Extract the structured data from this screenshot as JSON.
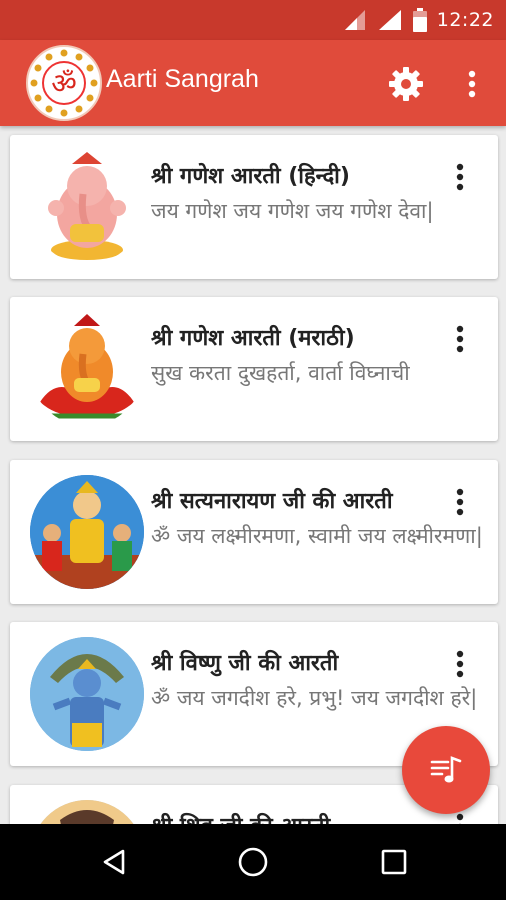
{
  "status_bar": {
    "time": "12:22",
    "icons": [
      "signal-icon",
      "wifi-icon",
      "battery-icon"
    ]
  },
  "app_bar": {
    "title": "Aarti Sangrah",
    "logo_icon": "om-icon",
    "actions": [
      "settings-icon",
      "overflow-menu-icon"
    ],
    "color": "#e04b3b"
  },
  "aartis": [
    {
      "title": "श्री गणेश आरती (हिन्दी)",
      "subtitle": "जय गणेश जय गणेश जय गणेश देवा|",
      "image": "ganesh-pink-image"
    },
    {
      "title": "श्री गणेश आरती (मराठी)",
      "subtitle": "सुख करता दुखहर्ता, वार्ता विघ्नाची",
      "image": "ganesh-lotus-image"
    },
    {
      "title": "श्री सत्यनारायण जी की आरती",
      "subtitle": "ॐ जय लक्ष्मीरमणा, स्वामी जय लक्ष्मीरमणा|",
      "image": "satyanarayan-image"
    },
    {
      "title": "श्री विष्णु जी की आरती",
      "subtitle": "ॐ जय जगदीश हरे, प्रभु! जय जगदीश हरे|",
      "image": "vishnu-image"
    },
    {
      "title": "श्री शिव जी की आरती",
      "subtitle": "",
      "image": "shiva-image"
    }
  ],
  "fab": {
    "icon": "music-playlist-icon",
    "color": "#e8493b"
  },
  "nav_bar": {
    "buttons": [
      "back-icon",
      "home-icon",
      "recents-icon"
    ]
  }
}
